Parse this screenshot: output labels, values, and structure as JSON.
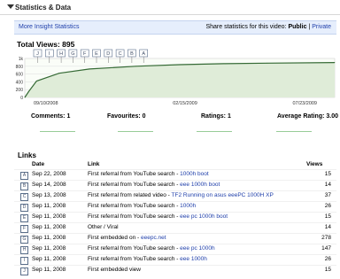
{
  "header": {
    "title": "Statistics & Data"
  },
  "bar": {
    "more_link": "More Insight Statistics",
    "share_prefix": "Share statistics for this video:",
    "public_label": "Public",
    "separator": "|",
    "private_label": "Private"
  },
  "total_views": "Total Views: 895",
  "chart_data": {
    "type": "area",
    "ylabels": [
      "1k",
      "800",
      "600",
      "400",
      "200",
      "0"
    ],
    "ylim": [
      0,
      1000
    ],
    "xlabels": [
      "09/10/2008",
      "02/15/2009",
      "07/23/2009"
    ],
    "x": [
      "2008-09-10",
      "2008-09-14",
      "2008-09-22",
      "2008-10-15",
      "2008-11-15",
      "2009-01-01",
      "2009-02-15",
      "2009-04-01",
      "2009-05-15",
      "2009-07-23"
    ],
    "values": [
      0,
      150,
      420,
      620,
      730,
      800,
      840,
      865,
      880,
      895
    ],
    "fill_color": "#dfecd8",
    "line_color": "#356a35",
    "markers": [
      "J",
      "I",
      "H",
      "G",
      "F",
      "E",
      "D",
      "C",
      "B",
      "A"
    ]
  },
  "stats": [
    {
      "label": "Comments: 1"
    },
    {
      "label": "Favourites: 0"
    },
    {
      "label": "Ratings: 1"
    },
    {
      "label": "Average Rating: 3.00"
    }
  ],
  "links": {
    "title": "Links",
    "columns": {
      "date": "Date",
      "link": "Link",
      "views": "Views"
    },
    "rows": [
      {
        "marker": "A",
        "date": "Sep 22, 2008",
        "text": "First referral from YouTube search - ",
        "link": "1000h boot",
        "views": "15"
      },
      {
        "marker": "B",
        "date": "Sep 14, 2008",
        "text": "First referral from YouTube search - ",
        "link": "eee 1000h boot",
        "views": "14"
      },
      {
        "marker": "C",
        "date": "Sep 13, 2008",
        "text": "First referral from related video - ",
        "link": "TF2 Running on asus eeePC 1000H XP",
        "views": "37"
      },
      {
        "marker": "D",
        "date": "Sep 11, 2008",
        "text": "First referral from YouTube search - ",
        "link": "1000h",
        "views": "26"
      },
      {
        "marker": "E",
        "date": "Sep 11, 2008",
        "text": "First referral from YouTube search - ",
        "link": "eee pc 1000h boot",
        "views": "15"
      },
      {
        "marker": "F",
        "date": "Sep 11, 2008",
        "text": "Other / Viral",
        "link": "",
        "views": "14"
      },
      {
        "marker": "G",
        "date": "Sep 11, 2008",
        "text": "First embedded on - ",
        "link": "eeepc.net",
        "views": "278"
      },
      {
        "marker": "H",
        "date": "Sep 11, 2008",
        "text": "First referral from YouTube search - ",
        "link": "eee pc 1000h",
        "views": "147"
      },
      {
        "marker": "I",
        "date": "Sep 11, 2008",
        "text": "First referral from YouTube search - ",
        "link": "eee 1000h",
        "views": "26"
      },
      {
        "marker": "J",
        "date": "Sep 11, 2008",
        "text": "First embedded view",
        "link": "",
        "views": "15"
      }
    ]
  }
}
